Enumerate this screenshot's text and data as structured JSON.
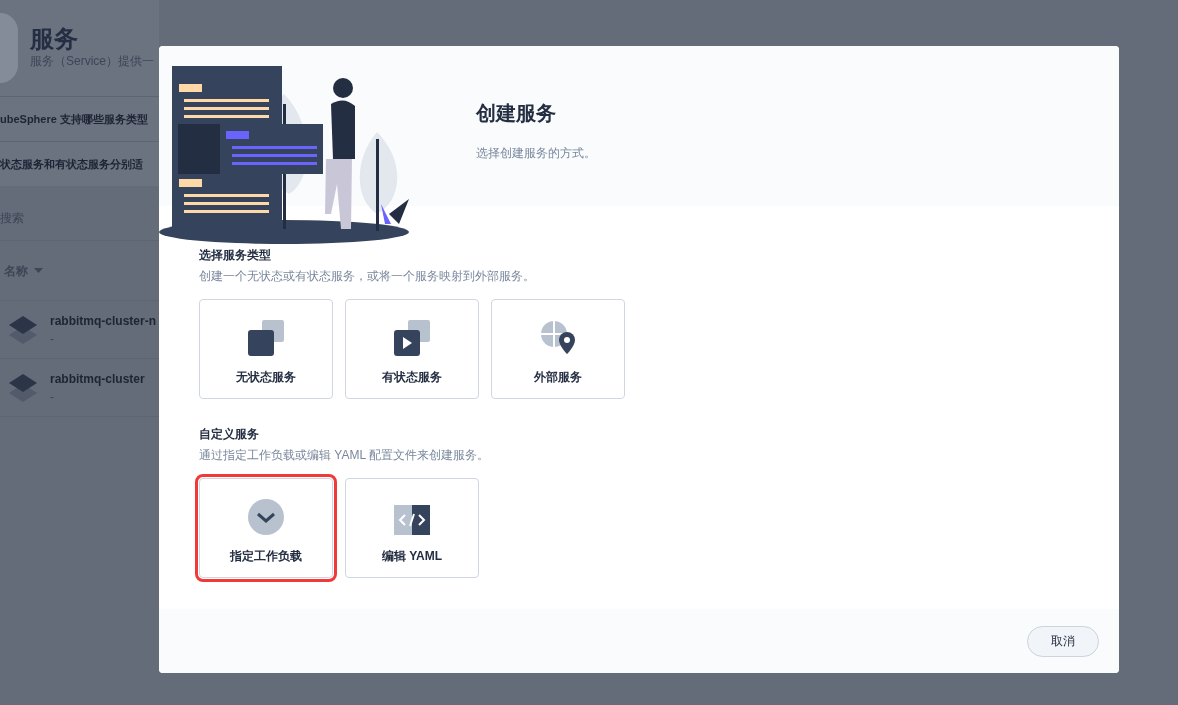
{
  "background_page": {
    "title": "服务",
    "subtitle": "服务（Service）提供一",
    "faq": [
      "ubeSphere 支持哪些服务类型",
      "状态服务和有状态服务分别适"
    ],
    "search_placeholder": "搜索",
    "column": "名称",
    "rows": [
      {
        "name": "rabbitmq-cluster-n",
        "description": "-"
      },
      {
        "name": "rabbitmq-cluster",
        "description": "-"
      }
    ]
  },
  "dialog": {
    "title": "创建服务",
    "subtitle": "选择创建服务的方式。",
    "sections": [
      {
        "title": "选择服务类型",
        "description": "创建一个无状态或有状态服务，或将一个服务映射到外部服务。",
        "options": [
          {
            "label": "无状态服务",
            "kind": "stateless",
            "selected": false
          },
          {
            "label": "有状态服务",
            "kind": "stateful",
            "selected": false
          },
          {
            "label": "外部服务",
            "kind": "external",
            "selected": false
          }
        ]
      },
      {
        "title": "自定义服务",
        "description": "通过指定工作负载或编辑 YAML 配置文件来创建服务。",
        "options": [
          {
            "label": "指定工作负载",
            "kind": "workload",
            "selected": true
          },
          {
            "label": "编辑 YAML",
            "kind": "yaml",
            "selected": false
          }
        ]
      }
    ],
    "cancel": "取消"
  }
}
